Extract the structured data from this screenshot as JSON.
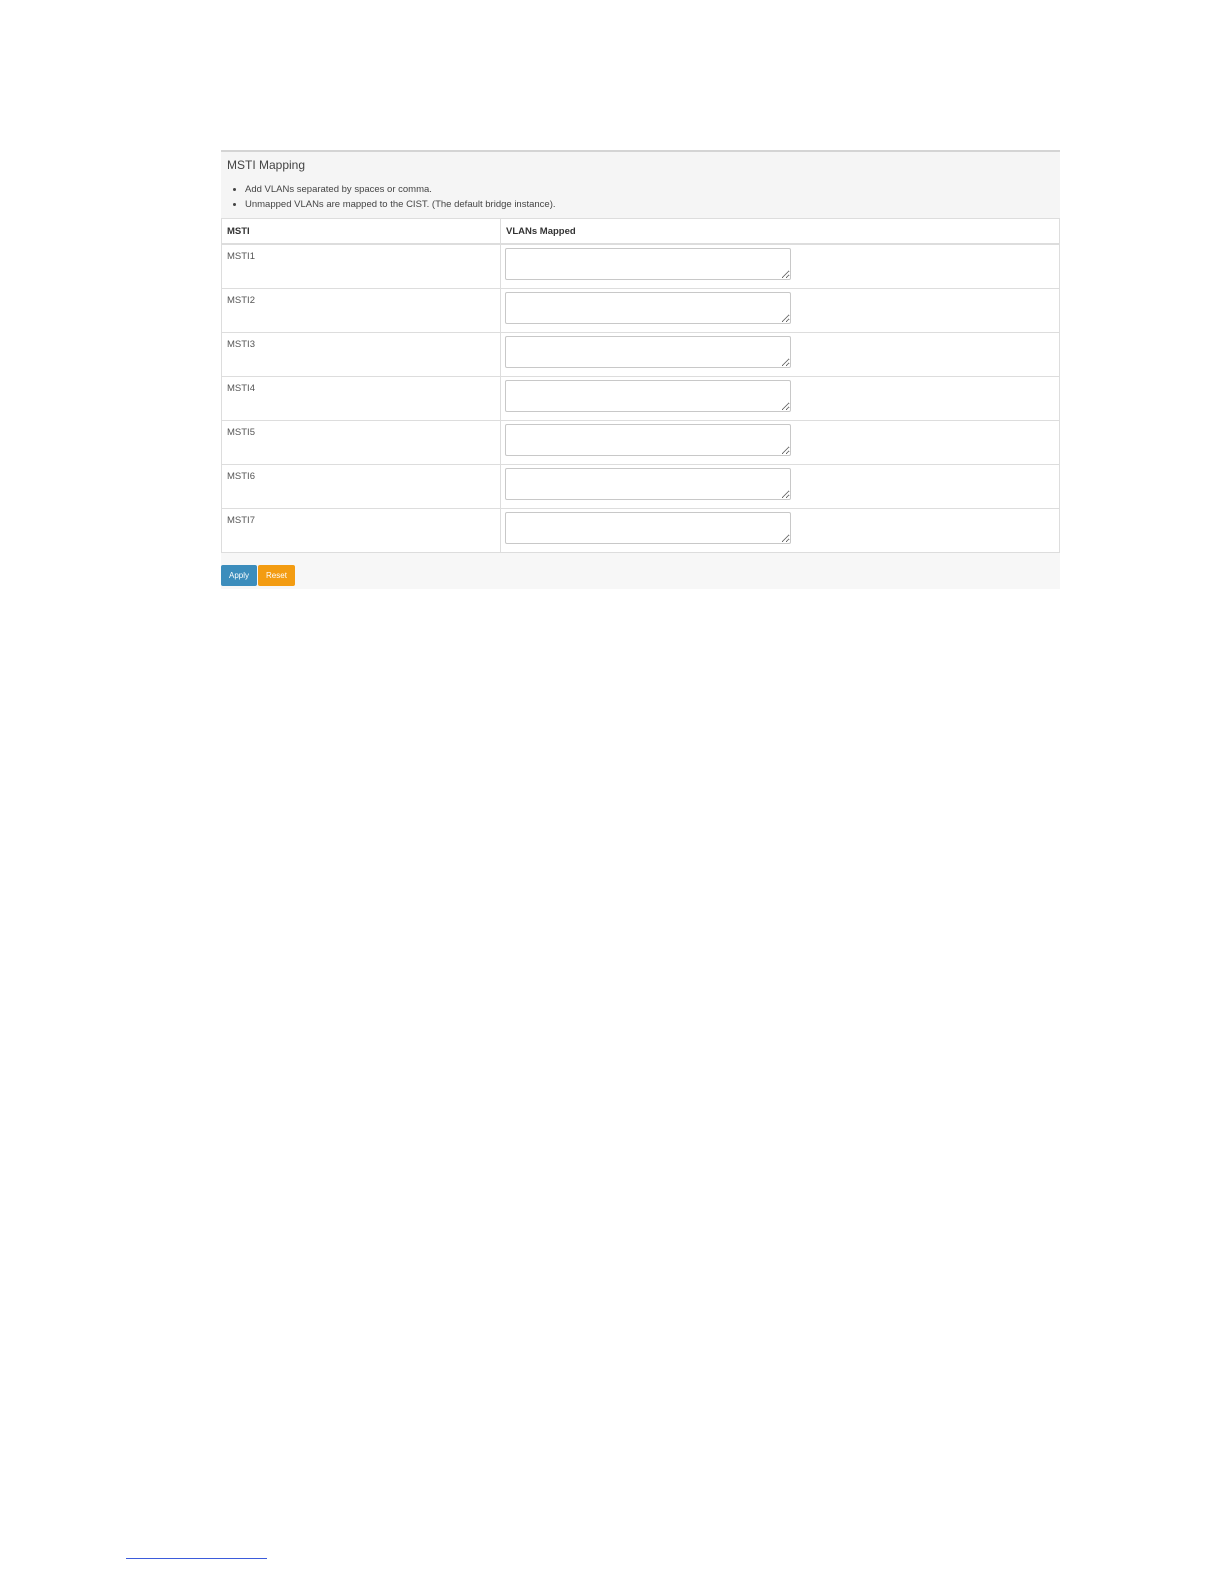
{
  "panel": {
    "title": "MSTI Mapping",
    "notes": [
      "Add VLANs separated by spaces or comma.",
      "Unmapped VLANs are mapped to the CIST. (The default bridge instance)."
    ]
  },
  "table": {
    "headers": {
      "msti": "MSTI",
      "vlans": "VLANs Mapped"
    },
    "rows": [
      {
        "msti": "MSTI1",
        "vlans": ""
      },
      {
        "msti": "MSTI2",
        "vlans": ""
      },
      {
        "msti": "MSTI3",
        "vlans": ""
      },
      {
        "msti": "MSTI4",
        "vlans": ""
      },
      {
        "msti": "MSTI5",
        "vlans": ""
      },
      {
        "msti": "MSTI6",
        "vlans": ""
      },
      {
        "msti": "MSTI7",
        "vlans": ""
      }
    ]
  },
  "actions": {
    "apply_label": "Apply",
    "reset_label": "Reset"
  },
  "colors": {
    "apply": "#3c8dbc",
    "reset": "#f39c12",
    "footnote_rule": "#3b5bdb"
  }
}
